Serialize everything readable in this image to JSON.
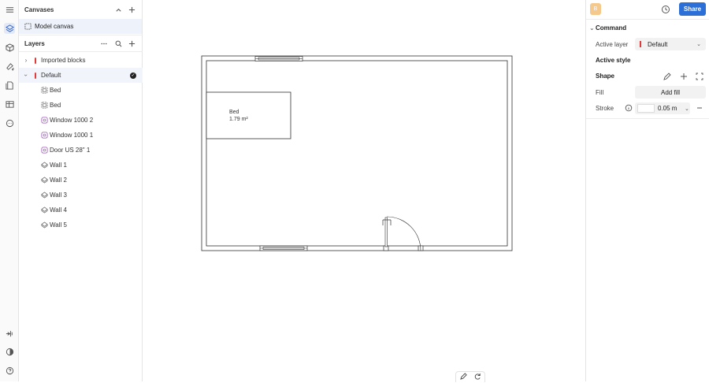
{
  "left_panel": {
    "canvases_title": "Canvases",
    "canvas_item": "Model canvas",
    "layers_title": "Layers",
    "layers": [
      {
        "label": "Imported blocks"
      },
      {
        "label": "Default"
      },
      {
        "label": "Bed"
      },
      {
        "label": "Bed"
      },
      {
        "label": "Window 1000 2"
      },
      {
        "label": "Window 1000 1"
      },
      {
        "label": "Door US 28\" 1"
      },
      {
        "label": "Wall 1"
      },
      {
        "label": "Wall 2"
      },
      {
        "label": "Wall 3"
      },
      {
        "label": "Wall 4"
      },
      {
        "label": "Wall 5"
      }
    ]
  },
  "canvas": {
    "bed_label": "Bed",
    "bed_area": "1.79 m²"
  },
  "right_panel": {
    "avatar_letter": "B",
    "share_label": "Share",
    "command_title": "Command",
    "active_layer_label": "Active layer",
    "active_layer_value": "Default",
    "active_style_title": "Active style",
    "shape_title": "Shape",
    "fill_label": "Fill",
    "add_fill_label": "Add fill",
    "stroke_label": "Stroke",
    "stroke_width": "0.05 m"
  },
  "colors": {
    "accent": "#2c6fd6",
    "layer_marker": "#e03a3a",
    "avatar": "#f4c98b"
  }
}
